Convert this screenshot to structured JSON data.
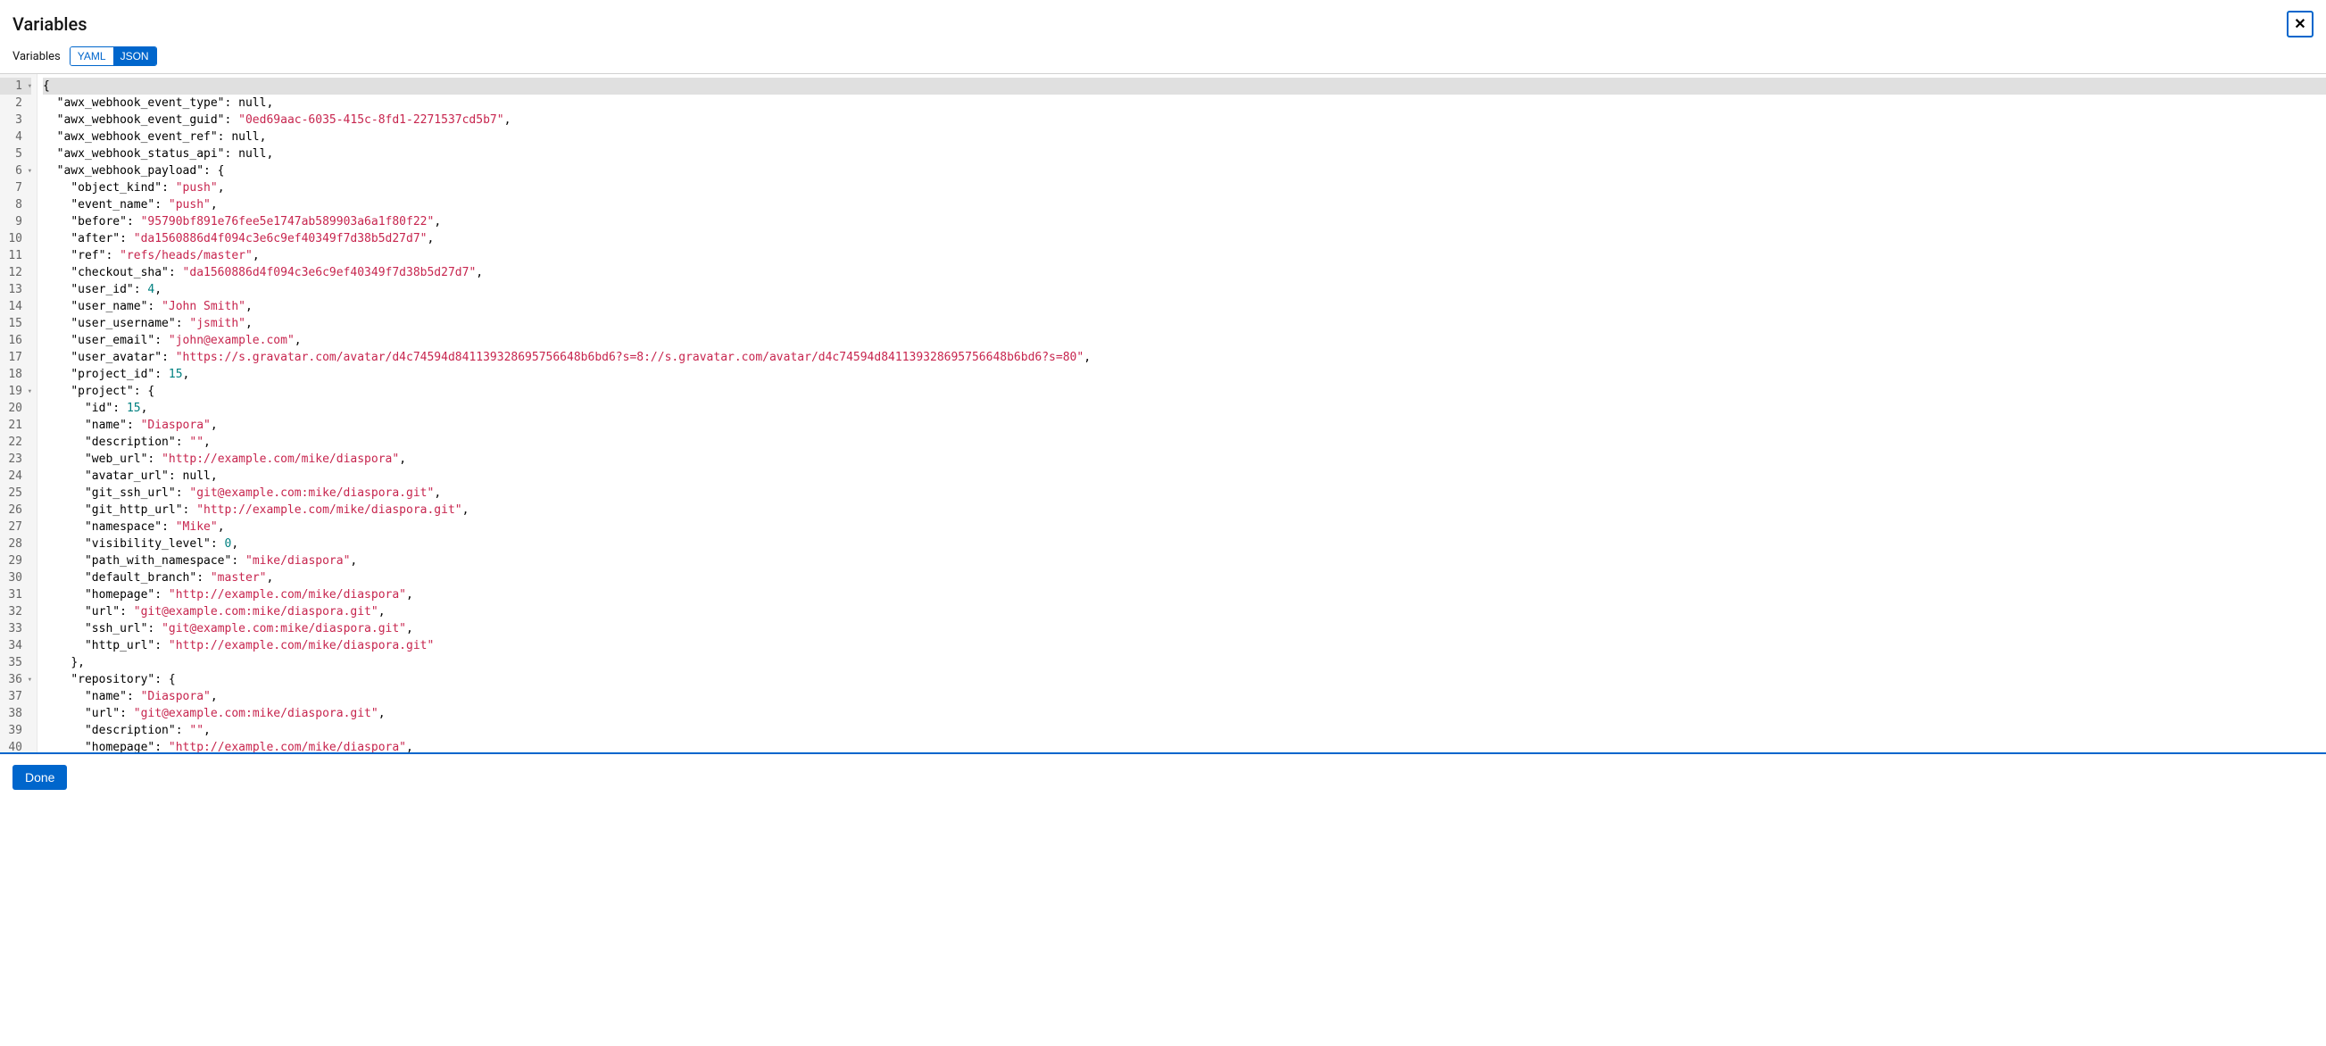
{
  "header": {
    "title": "Variables",
    "close_icon": "✕"
  },
  "toolbar": {
    "label": "Variables",
    "yaml": "YAML",
    "json": "JSON"
  },
  "footer": {
    "done": "Done"
  },
  "code": {
    "lines": [
      {
        "n": 1,
        "fold": true,
        "hl": true,
        "tokens": [
          [
            "p",
            "{"
          ]
        ]
      },
      {
        "n": 2,
        "tokens": [
          [
            "i",
            1
          ],
          [
            "k",
            "\"awx_webhook_event_type\""
          ],
          [
            "p",
            ": "
          ],
          [
            "nl",
            "null"
          ],
          [
            "p",
            ","
          ]
        ]
      },
      {
        "n": 3,
        "tokens": [
          [
            "i",
            1
          ],
          [
            "k",
            "\"awx_webhook_event_guid\""
          ],
          [
            "p",
            ": "
          ],
          [
            "s",
            "\"0ed69aac-6035-415c-8fd1-2271537cd5b7\""
          ],
          [
            "p",
            ","
          ]
        ]
      },
      {
        "n": 4,
        "tokens": [
          [
            "i",
            1
          ],
          [
            "k",
            "\"awx_webhook_event_ref\""
          ],
          [
            "p",
            ": "
          ],
          [
            "nl",
            "null"
          ],
          [
            "p",
            ","
          ]
        ]
      },
      {
        "n": 5,
        "tokens": [
          [
            "i",
            1
          ],
          [
            "k",
            "\"awx_webhook_status_api\""
          ],
          [
            "p",
            ": "
          ],
          [
            "nl",
            "null"
          ],
          [
            "p",
            ","
          ]
        ]
      },
      {
        "n": 6,
        "fold": true,
        "tokens": [
          [
            "i",
            1
          ],
          [
            "k",
            "\"awx_webhook_payload\""
          ],
          [
            "p",
            ": {"
          ]
        ]
      },
      {
        "n": 7,
        "tokens": [
          [
            "i",
            2
          ],
          [
            "k",
            "\"object_kind\""
          ],
          [
            "p",
            ": "
          ],
          [
            "s",
            "\"push\""
          ],
          [
            "p",
            ","
          ]
        ]
      },
      {
        "n": 8,
        "tokens": [
          [
            "i",
            2
          ],
          [
            "k",
            "\"event_name\""
          ],
          [
            "p",
            ": "
          ],
          [
            "s",
            "\"push\""
          ],
          [
            "p",
            ","
          ]
        ]
      },
      {
        "n": 9,
        "tokens": [
          [
            "i",
            2
          ],
          [
            "k",
            "\"before\""
          ],
          [
            "p",
            ": "
          ],
          [
            "s",
            "\"95790bf891e76fee5e1747ab589903a6a1f80f22\""
          ],
          [
            "p",
            ","
          ]
        ]
      },
      {
        "n": 10,
        "tokens": [
          [
            "i",
            2
          ],
          [
            "k",
            "\"after\""
          ],
          [
            "p",
            ": "
          ],
          [
            "s",
            "\"da1560886d4f094c3e6c9ef40349f7d38b5d27d7\""
          ],
          [
            "p",
            ","
          ]
        ]
      },
      {
        "n": 11,
        "tokens": [
          [
            "i",
            2
          ],
          [
            "k",
            "\"ref\""
          ],
          [
            "p",
            ": "
          ],
          [
            "s",
            "\"refs/heads/master\""
          ],
          [
            "p",
            ","
          ]
        ]
      },
      {
        "n": 12,
        "tokens": [
          [
            "i",
            2
          ],
          [
            "k",
            "\"checkout_sha\""
          ],
          [
            "p",
            ": "
          ],
          [
            "s",
            "\"da1560886d4f094c3e6c9ef40349f7d38b5d27d7\""
          ],
          [
            "p",
            ","
          ]
        ]
      },
      {
        "n": 13,
        "tokens": [
          [
            "i",
            2
          ],
          [
            "k",
            "\"user_id\""
          ],
          [
            "p",
            ": "
          ],
          [
            "n",
            "4"
          ],
          [
            "p",
            ","
          ]
        ]
      },
      {
        "n": 14,
        "tokens": [
          [
            "i",
            2
          ],
          [
            "k",
            "\"user_name\""
          ],
          [
            "p",
            ": "
          ],
          [
            "s",
            "\"John Smith\""
          ],
          [
            "p",
            ","
          ]
        ]
      },
      {
        "n": 15,
        "tokens": [
          [
            "i",
            2
          ],
          [
            "k",
            "\"user_username\""
          ],
          [
            "p",
            ": "
          ],
          [
            "s",
            "\"jsmith\""
          ],
          [
            "p",
            ","
          ]
        ]
      },
      {
        "n": 16,
        "tokens": [
          [
            "i",
            2
          ],
          [
            "k",
            "\"user_email\""
          ],
          [
            "p",
            ": "
          ],
          [
            "s",
            "\"john@example.com\""
          ],
          [
            "p",
            ","
          ]
        ]
      },
      {
        "n": 17,
        "tokens": [
          [
            "i",
            2
          ],
          [
            "k",
            "\"user_avatar\""
          ],
          [
            "p",
            ": "
          ],
          [
            "s",
            "\"https://s.gravatar.com/avatar/d4c74594d841139328695756648b6bd6?s=8://s.gravatar.com/avatar/d4c74594d841139328695756648b6bd6?s=80\""
          ],
          [
            "p",
            ","
          ]
        ]
      },
      {
        "n": 18,
        "tokens": [
          [
            "i",
            2
          ],
          [
            "k",
            "\"project_id\""
          ],
          [
            "p",
            ": "
          ],
          [
            "n",
            "15"
          ],
          [
            "p",
            ","
          ]
        ]
      },
      {
        "n": 19,
        "fold": true,
        "tokens": [
          [
            "i",
            2
          ],
          [
            "k",
            "\"project\""
          ],
          [
            "p",
            ": {"
          ]
        ]
      },
      {
        "n": 20,
        "tokens": [
          [
            "i",
            3
          ],
          [
            "k",
            "\"id\""
          ],
          [
            "p",
            ": "
          ],
          [
            "n",
            "15"
          ],
          [
            "p",
            ","
          ]
        ]
      },
      {
        "n": 21,
        "tokens": [
          [
            "i",
            3
          ],
          [
            "k",
            "\"name\""
          ],
          [
            "p",
            ": "
          ],
          [
            "s",
            "\"Diaspora\""
          ],
          [
            "p",
            ","
          ]
        ]
      },
      {
        "n": 22,
        "tokens": [
          [
            "i",
            3
          ],
          [
            "k",
            "\"description\""
          ],
          [
            "p",
            ": "
          ],
          [
            "s",
            "\"\""
          ],
          [
            "p",
            ","
          ]
        ]
      },
      {
        "n": 23,
        "tokens": [
          [
            "i",
            3
          ],
          [
            "k",
            "\"web_url\""
          ],
          [
            "p",
            ": "
          ],
          [
            "s",
            "\"http://example.com/mike/diaspora\""
          ],
          [
            "p",
            ","
          ]
        ]
      },
      {
        "n": 24,
        "tokens": [
          [
            "i",
            3
          ],
          [
            "k",
            "\"avatar_url\""
          ],
          [
            "p",
            ": "
          ],
          [
            "nl",
            "null"
          ],
          [
            "p",
            ","
          ]
        ]
      },
      {
        "n": 25,
        "tokens": [
          [
            "i",
            3
          ],
          [
            "k",
            "\"git_ssh_url\""
          ],
          [
            "p",
            ": "
          ],
          [
            "s",
            "\"git@example.com:mike/diaspora.git\""
          ],
          [
            "p",
            ","
          ]
        ]
      },
      {
        "n": 26,
        "tokens": [
          [
            "i",
            3
          ],
          [
            "k",
            "\"git_http_url\""
          ],
          [
            "p",
            ": "
          ],
          [
            "s",
            "\"http://example.com/mike/diaspora.git\""
          ],
          [
            "p",
            ","
          ]
        ]
      },
      {
        "n": 27,
        "tokens": [
          [
            "i",
            3
          ],
          [
            "k",
            "\"namespace\""
          ],
          [
            "p",
            ": "
          ],
          [
            "s",
            "\"Mike\""
          ],
          [
            "p",
            ","
          ]
        ]
      },
      {
        "n": 28,
        "tokens": [
          [
            "i",
            3
          ],
          [
            "k",
            "\"visibility_level\""
          ],
          [
            "p",
            ": "
          ],
          [
            "n",
            "0"
          ],
          [
            "p",
            ","
          ]
        ]
      },
      {
        "n": 29,
        "tokens": [
          [
            "i",
            3
          ],
          [
            "k",
            "\"path_with_namespace\""
          ],
          [
            "p",
            ": "
          ],
          [
            "s",
            "\"mike/diaspora\""
          ],
          [
            "p",
            ","
          ]
        ]
      },
      {
        "n": 30,
        "tokens": [
          [
            "i",
            3
          ],
          [
            "k",
            "\"default_branch\""
          ],
          [
            "p",
            ": "
          ],
          [
            "s",
            "\"master\""
          ],
          [
            "p",
            ","
          ]
        ]
      },
      {
        "n": 31,
        "tokens": [
          [
            "i",
            3
          ],
          [
            "k",
            "\"homepage\""
          ],
          [
            "p",
            ": "
          ],
          [
            "s",
            "\"http://example.com/mike/diaspora\""
          ],
          [
            "p",
            ","
          ]
        ]
      },
      {
        "n": 32,
        "tokens": [
          [
            "i",
            3
          ],
          [
            "k",
            "\"url\""
          ],
          [
            "p",
            ": "
          ],
          [
            "s",
            "\"git@example.com:mike/diaspora.git\""
          ],
          [
            "p",
            ","
          ]
        ]
      },
      {
        "n": 33,
        "tokens": [
          [
            "i",
            3
          ],
          [
            "k",
            "\"ssh_url\""
          ],
          [
            "p",
            ": "
          ],
          [
            "s",
            "\"git@example.com:mike/diaspora.git\""
          ],
          [
            "p",
            ","
          ]
        ]
      },
      {
        "n": 34,
        "tokens": [
          [
            "i",
            3
          ],
          [
            "k",
            "\"http_url\""
          ],
          [
            "p",
            ": "
          ],
          [
            "s",
            "\"http://example.com/mike/diaspora.git\""
          ]
        ]
      },
      {
        "n": 35,
        "tokens": [
          [
            "i",
            2
          ],
          [
            "p",
            "},"
          ]
        ]
      },
      {
        "n": 36,
        "fold": true,
        "tokens": [
          [
            "i",
            2
          ],
          [
            "k",
            "\"repository\""
          ],
          [
            "p",
            ": {"
          ]
        ]
      },
      {
        "n": 37,
        "tokens": [
          [
            "i",
            3
          ],
          [
            "k",
            "\"name\""
          ],
          [
            "p",
            ": "
          ],
          [
            "s",
            "\"Diaspora\""
          ],
          [
            "p",
            ","
          ]
        ]
      },
      {
        "n": 38,
        "tokens": [
          [
            "i",
            3
          ],
          [
            "k",
            "\"url\""
          ],
          [
            "p",
            ": "
          ],
          [
            "s",
            "\"git@example.com:mike/diaspora.git\""
          ],
          [
            "p",
            ","
          ]
        ]
      },
      {
        "n": 39,
        "tokens": [
          [
            "i",
            3
          ],
          [
            "k",
            "\"description\""
          ],
          [
            "p",
            ": "
          ],
          [
            "s",
            "\"\""
          ],
          [
            "p",
            ","
          ]
        ]
      },
      {
        "n": 40,
        "tokens": [
          [
            "i",
            3
          ],
          [
            "k",
            "\"homepage\""
          ],
          [
            "p",
            ": "
          ],
          [
            "s",
            "\"http://example.com/mike/diaspora\""
          ],
          [
            "p",
            ","
          ]
        ]
      }
    ]
  }
}
